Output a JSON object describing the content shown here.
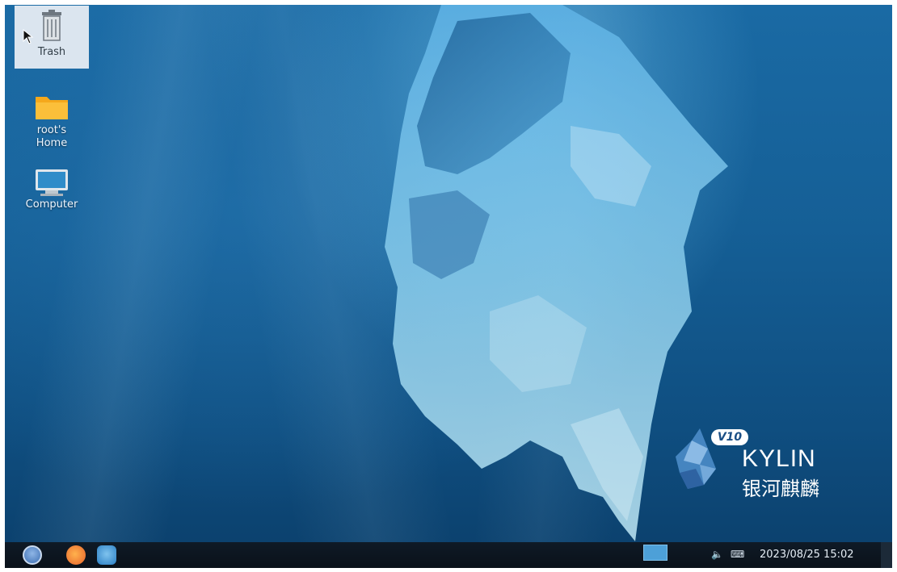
{
  "desktop": {
    "icons": [
      {
        "label": "Trash",
        "icon": "trash-icon"
      },
      {
        "label": "root's Home",
        "icon": "folder-icon"
      },
      {
        "label": "Computer",
        "icon": "computer-icon"
      }
    ]
  },
  "wallpaper": {
    "logo_badge": "V10",
    "logo_name": "KYLIN",
    "logo_chinese": "银河麒麟"
  },
  "taskbar": {
    "start_icon": "start-menu-icon",
    "browser_icon": "firefox-icon",
    "files_icon": "file-manager-icon",
    "volume_icon": "volume-icon",
    "network_icon": "network-icon",
    "clock": "2023/08/25 15:02"
  },
  "colors": {
    "wallpaper_top": "#1a6aa4",
    "wallpaper_bottom": "#0b3f6b",
    "taskbar": "#0f1a26",
    "selection": "#ebf0f5"
  }
}
